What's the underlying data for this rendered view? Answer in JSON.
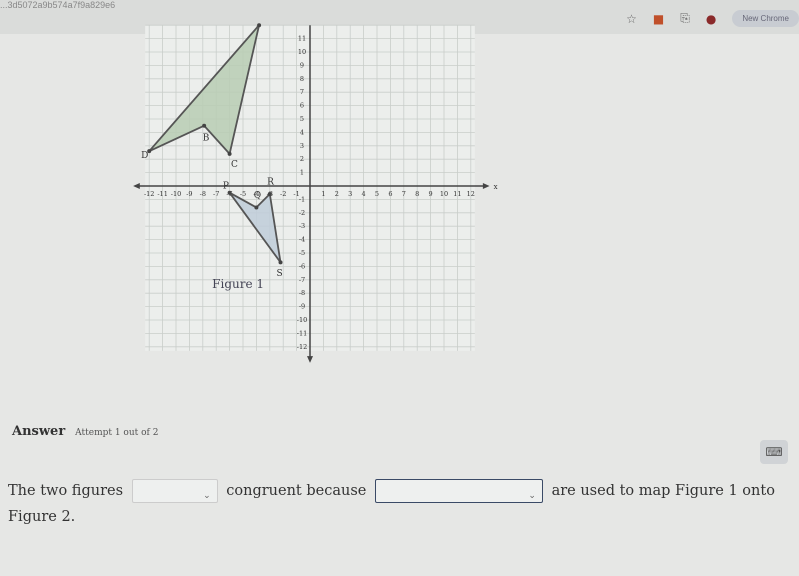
{
  "browser": {
    "url_fragment": "...3d5072a9b574a7f9a829e6",
    "new_chrome_label": "New Chrome",
    "icons": [
      "star-icon",
      "bookmark-icon",
      "extension-icon",
      "profile-icon"
    ]
  },
  "graph": {
    "x_label": "x",
    "x_ticks": [
      -12,
      -11,
      -10,
      -9,
      -8,
      -7,
      -6,
      -5,
      -4,
      -3,
      -2,
      -1,
      1,
      2,
      3,
      4,
      5,
      6,
      7,
      8,
      9,
      10,
      11,
      12
    ],
    "y_ticks": [
      -12,
      -11,
      -10,
      -9,
      -8,
      -7,
      -6,
      -5,
      -4,
      -3,
      -2,
      -1,
      1,
      2,
      3,
      4,
      5,
      6,
      7,
      8,
      9,
      10,
      11
    ],
    "range": [
      -12,
      12
    ],
    "grid": true,
    "figure_large": {
      "fill": "#b9cdb4",
      "points": [
        [
          -3.8,
          12
        ],
        [
          -6,
          2.4
        ],
        [
          -7.9,
          4.5
        ],
        [
          -12,
          2.6
        ]
      ],
      "labels": [
        {
          "text": "B",
          "at": [
            -8,
            3.4
          ]
        },
        {
          "text": "C",
          "at": [
            -5.9,
            1.4
          ]
        },
        {
          "text": "D",
          "at": [
            -12.6,
            2.1
          ]
        }
      ]
    },
    "figure_small": {
      "fill": "#bfccd9",
      "points": [
        [
          -6,
          -0.5
        ],
        [
          -4,
          -1.6
        ],
        [
          -3,
          -0.6
        ],
        [
          -2.2,
          -5.7
        ]
      ],
      "labels": [
        {
          "text": "P",
          "at": [
            -6.5,
            -0.2
          ]
        },
        {
          "text": "Q",
          "at": [
            -4.2,
            -0.9
          ]
        },
        {
          "text": "R",
          "at": [
            -3.2,
            0.1
          ]
        },
        {
          "text": "S",
          "at": [
            -2.5,
            -6.7
          ]
        }
      ]
    },
    "figure_caption": "Figure 1"
  },
  "answer": {
    "label": "Answer",
    "attempt": "Attempt 1 out of 2",
    "sentence_part1": "The two figures",
    "sentence_part2": "congruent because",
    "sentence_part3": "are used to map Figure 1 onto Figure 2.",
    "dropdown1_value": "",
    "dropdown2_value": ""
  }
}
